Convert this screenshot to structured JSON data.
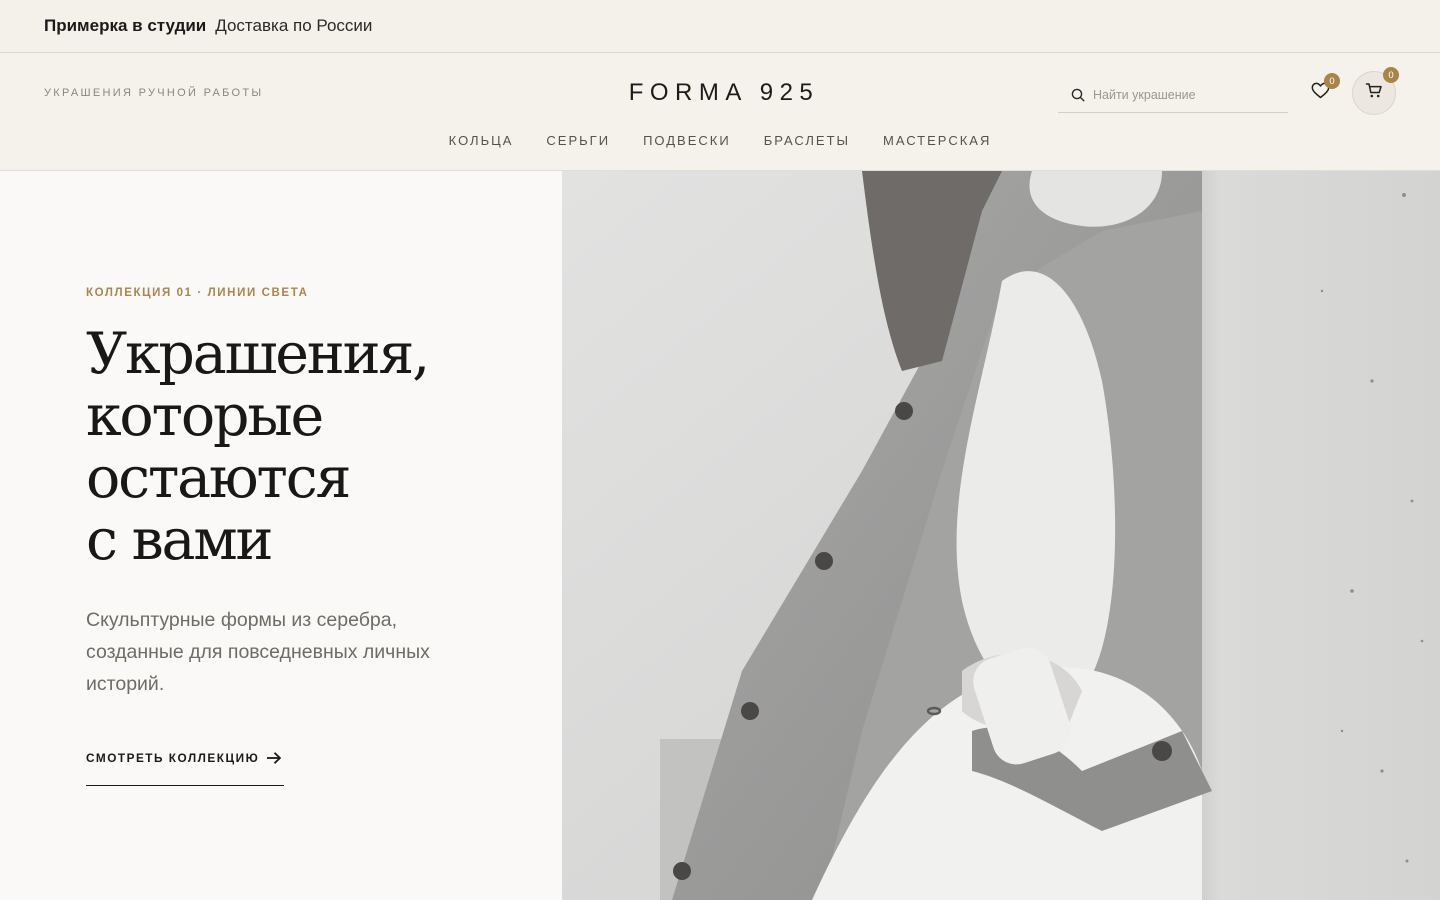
{
  "topbar": {
    "studio": "Примерка в студии",
    "delivery": "Доставка по России"
  },
  "header": {
    "tagline": "УКРАШЕНИЯ РУЧНОЙ РАБОТЫ",
    "logo": "FORMA 925",
    "search_placeholder": "Найти украшение",
    "wishlist_count": "0",
    "cart_count": "0"
  },
  "nav": {
    "items": [
      "КОЛЬЦА",
      "СЕРЬГИ",
      "ПОДВЕСКИ",
      "БРАСЛЕТЫ",
      "МАСТЕРСКАЯ"
    ]
  },
  "hero": {
    "kicker": "КОЛЛЕКЦИЯ 01 · ЛИНИИ СВЕТА",
    "headline_lines": [
      "Украшения,",
      "которые",
      "остаются",
      "с вами"
    ],
    "subtitle": "Скульптурные формы из серебра, созданные для повседневных личных историй.",
    "cta": "СМОТРЕТЬ КОЛЛЕКЦИЮ"
  },
  "icons": {
    "search": "search-icon",
    "wishlist": "heart-icon",
    "cart": "cart-icon",
    "cta_arrow": "arrow-right-icon"
  },
  "colors": {
    "accent": "#a8834a",
    "background": "#f5f2eb",
    "text": "#1d1b19"
  }
}
